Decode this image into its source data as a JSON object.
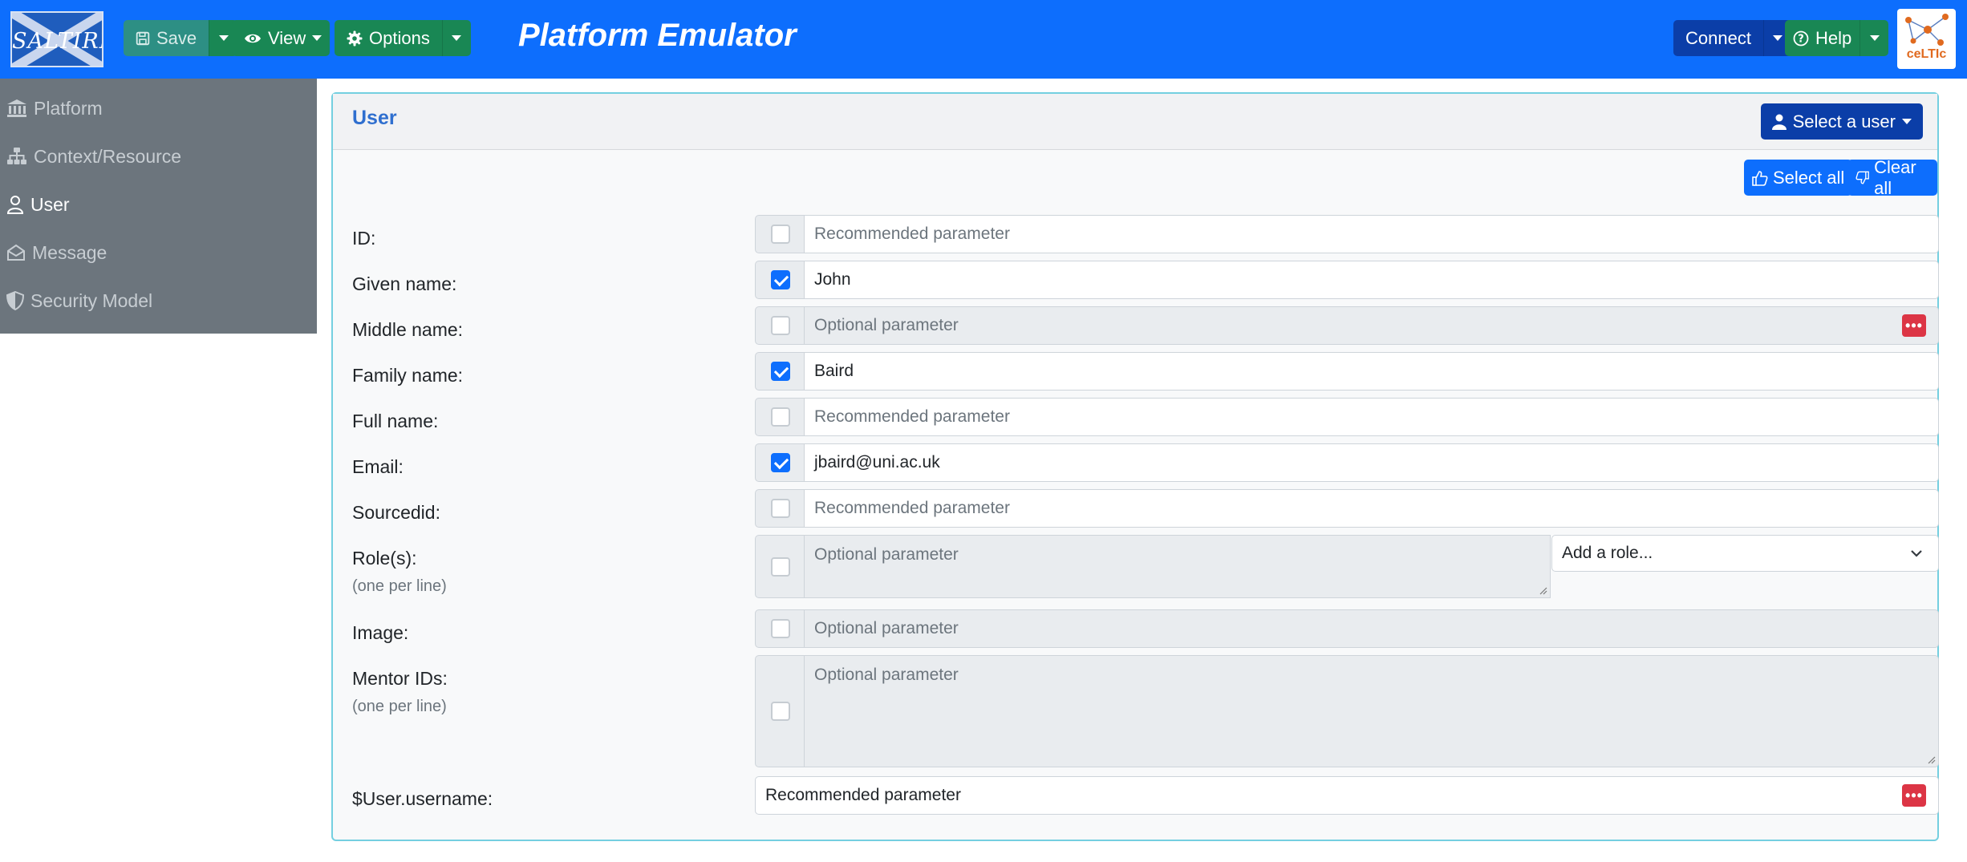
{
  "navbar": {
    "logo_text": "SALTIRE",
    "save_label": "Save",
    "view_label": "View",
    "options_label": "Options",
    "title": "Platform Emulator",
    "connect_label": "Connect",
    "help_label": "Help",
    "celtic_text": "ceLTIc",
    "brand_color": "#0d6efd"
  },
  "sidebar": {
    "items": [
      {
        "label": "Platform",
        "icon": "bank-icon",
        "active": false
      },
      {
        "label": "Context/Resource",
        "icon": "sitemap-icon",
        "active": false
      },
      {
        "label": "User",
        "icon": "person-icon",
        "active": true
      },
      {
        "label": "Message",
        "icon": "envelope-icon",
        "active": false
      },
      {
        "label": "Security Model",
        "icon": "shield-icon",
        "active": false
      }
    ]
  },
  "card": {
    "title": "User",
    "select_user_label": "Select a user",
    "select_all_label": "Select all",
    "clear_all_label": "Clear all"
  },
  "form": {
    "rows": [
      {
        "label": "ID:",
        "checked": false,
        "value": "",
        "placeholder": "Recommended parameter"
      },
      {
        "label": "Given name:",
        "checked": true,
        "value": "John",
        "placeholder": ""
      },
      {
        "label": "Middle name:",
        "checked": false,
        "value": "",
        "placeholder": "Optional parameter",
        "disabled": true
      },
      {
        "label": "Family name:",
        "checked": true,
        "value": "Baird",
        "placeholder": ""
      },
      {
        "label": "Full name:",
        "checked": false,
        "value": "",
        "placeholder": "Recommended parameter"
      },
      {
        "label": "Email:",
        "checked": true,
        "value": "jbaird@uni.ac.uk",
        "placeholder": ""
      },
      {
        "label": "Sourcedid:",
        "checked": false,
        "value": "",
        "placeholder": "Recommended parameter"
      },
      {
        "label": "Role(s):",
        "hint": "(one per line)",
        "checked": false,
        "value": "",
        "placeholder": "Optional parameter",
        "disabled": true
      },
      {
        "label": "Image:",
        "checked": false,
        "value": "",
        "placeholder": "Optional parameter",
        "disabled": true
      },
      {
        "label": "Mentor IDs:",
        "hint": "(one per line)",
        "checked": false,
        "value": "",
        "placeholder": "Optional parameter",
        "disabled": true
      },
      {
        "label": "$User.username:",
        "value": "",
        "placeholder": "Recommended parameter"
      }
    ],
    "role_select_label": "Add a role...",
    "more_label": "•••"
  }
}
